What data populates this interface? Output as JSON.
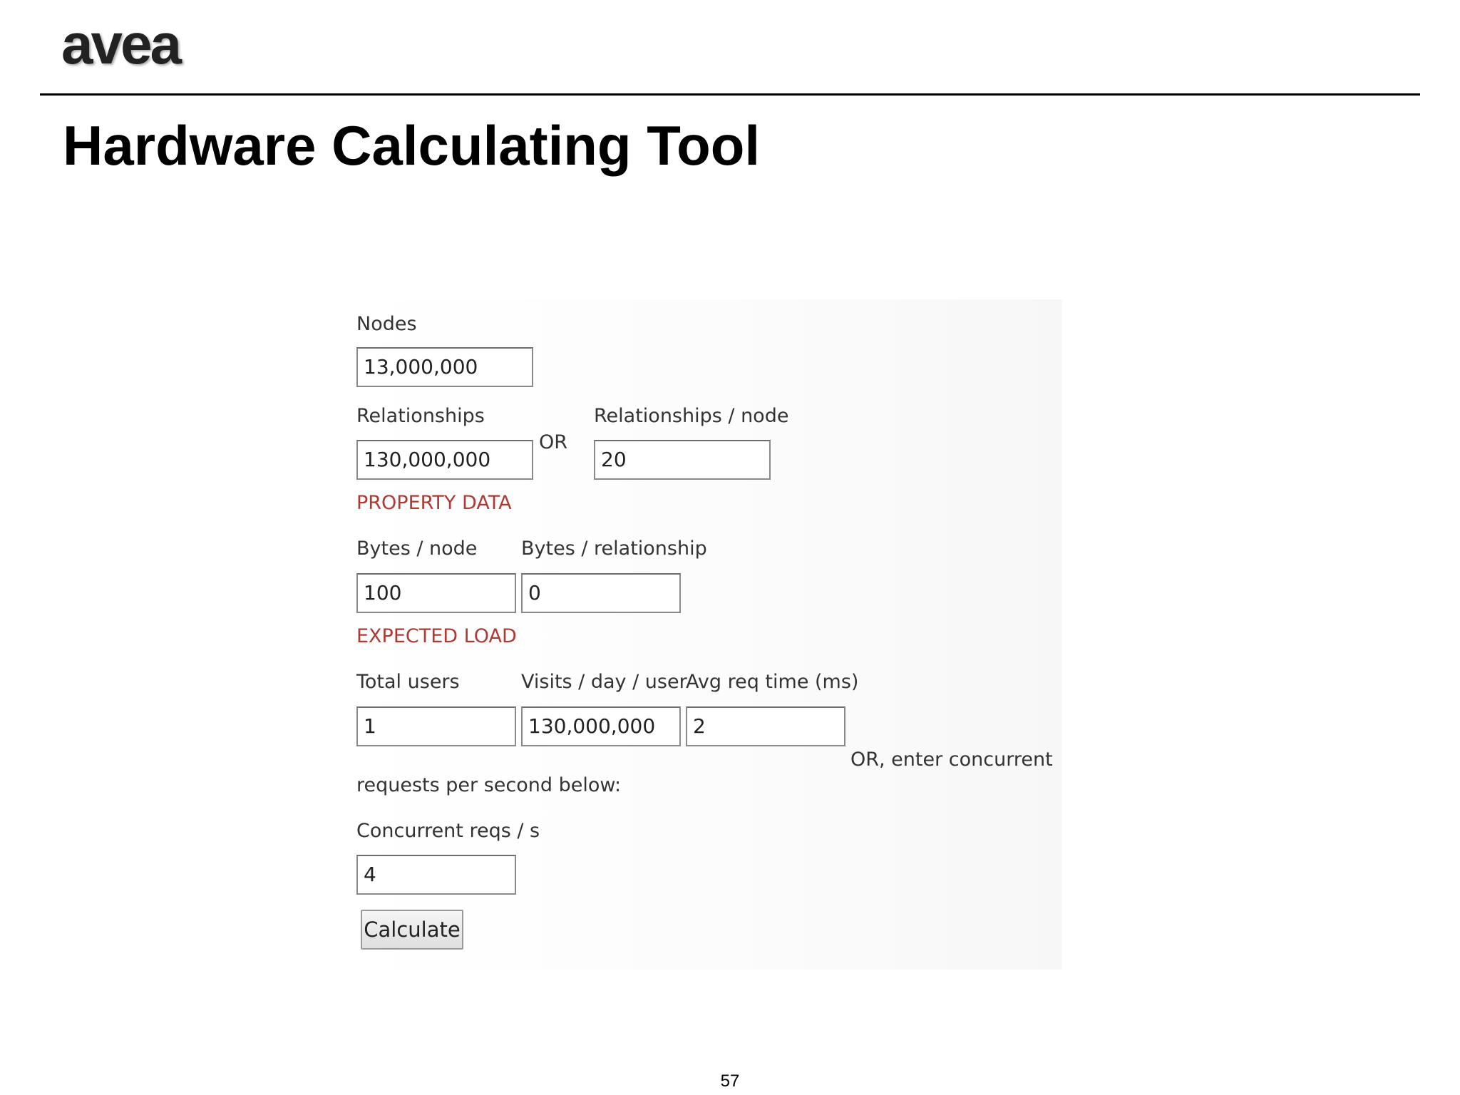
{
  "header": {
    "logo_text": "avea",
    "title": "Hardware Calculating Tool"
  },
  "form": {
    "nodes": {
      "label": "Nodes",
      "value": "13,000,000"
    },
    "relationships": {
      "label": "Relationships",
      "value": "130,000,000"
    },
    "or_label": "OR",
    "relationships_per_node": {
      "label": "Relationships / node",
      "value": "20"
    },
    "property_data_heading": "PROPERTY DATA",
    "bytes_per_node": {
      "label": "Bytes / node",
      "value": "100"
    },
    "bytes_per_relationship": {
      "label": "Bytes / relationship",
      "value": "0"
    },
    "expected_load_heading": "EXPECTED LOAD",
    "total_users": {
      "label": "Total users",
      "value": "1"
    },
    "visits_per_day_user": {
      "label": "Visits / day / user",
      "value": "130,000,000"
    },
    "avg_req_time": {
      "label": "Avg req time (ms)",
      "value": "2"
    },
    "or_concurrent_note_line1": "OR, enter concurrent",
    "or_concurrent_note_line2": "requests per second below:",
    "concurrent_reqs": {
      "label": "Concurrent reqs / s",
      "value": "4"
    },
    "calculate_button": "Calculate"
  },
  "footer": {
    "page_number": "57"
  },
  "colors": {
    "section_heading": "#b03a32",
    "input_border": "#8a8a8a",
    "rule": "#000000"
  }
}
